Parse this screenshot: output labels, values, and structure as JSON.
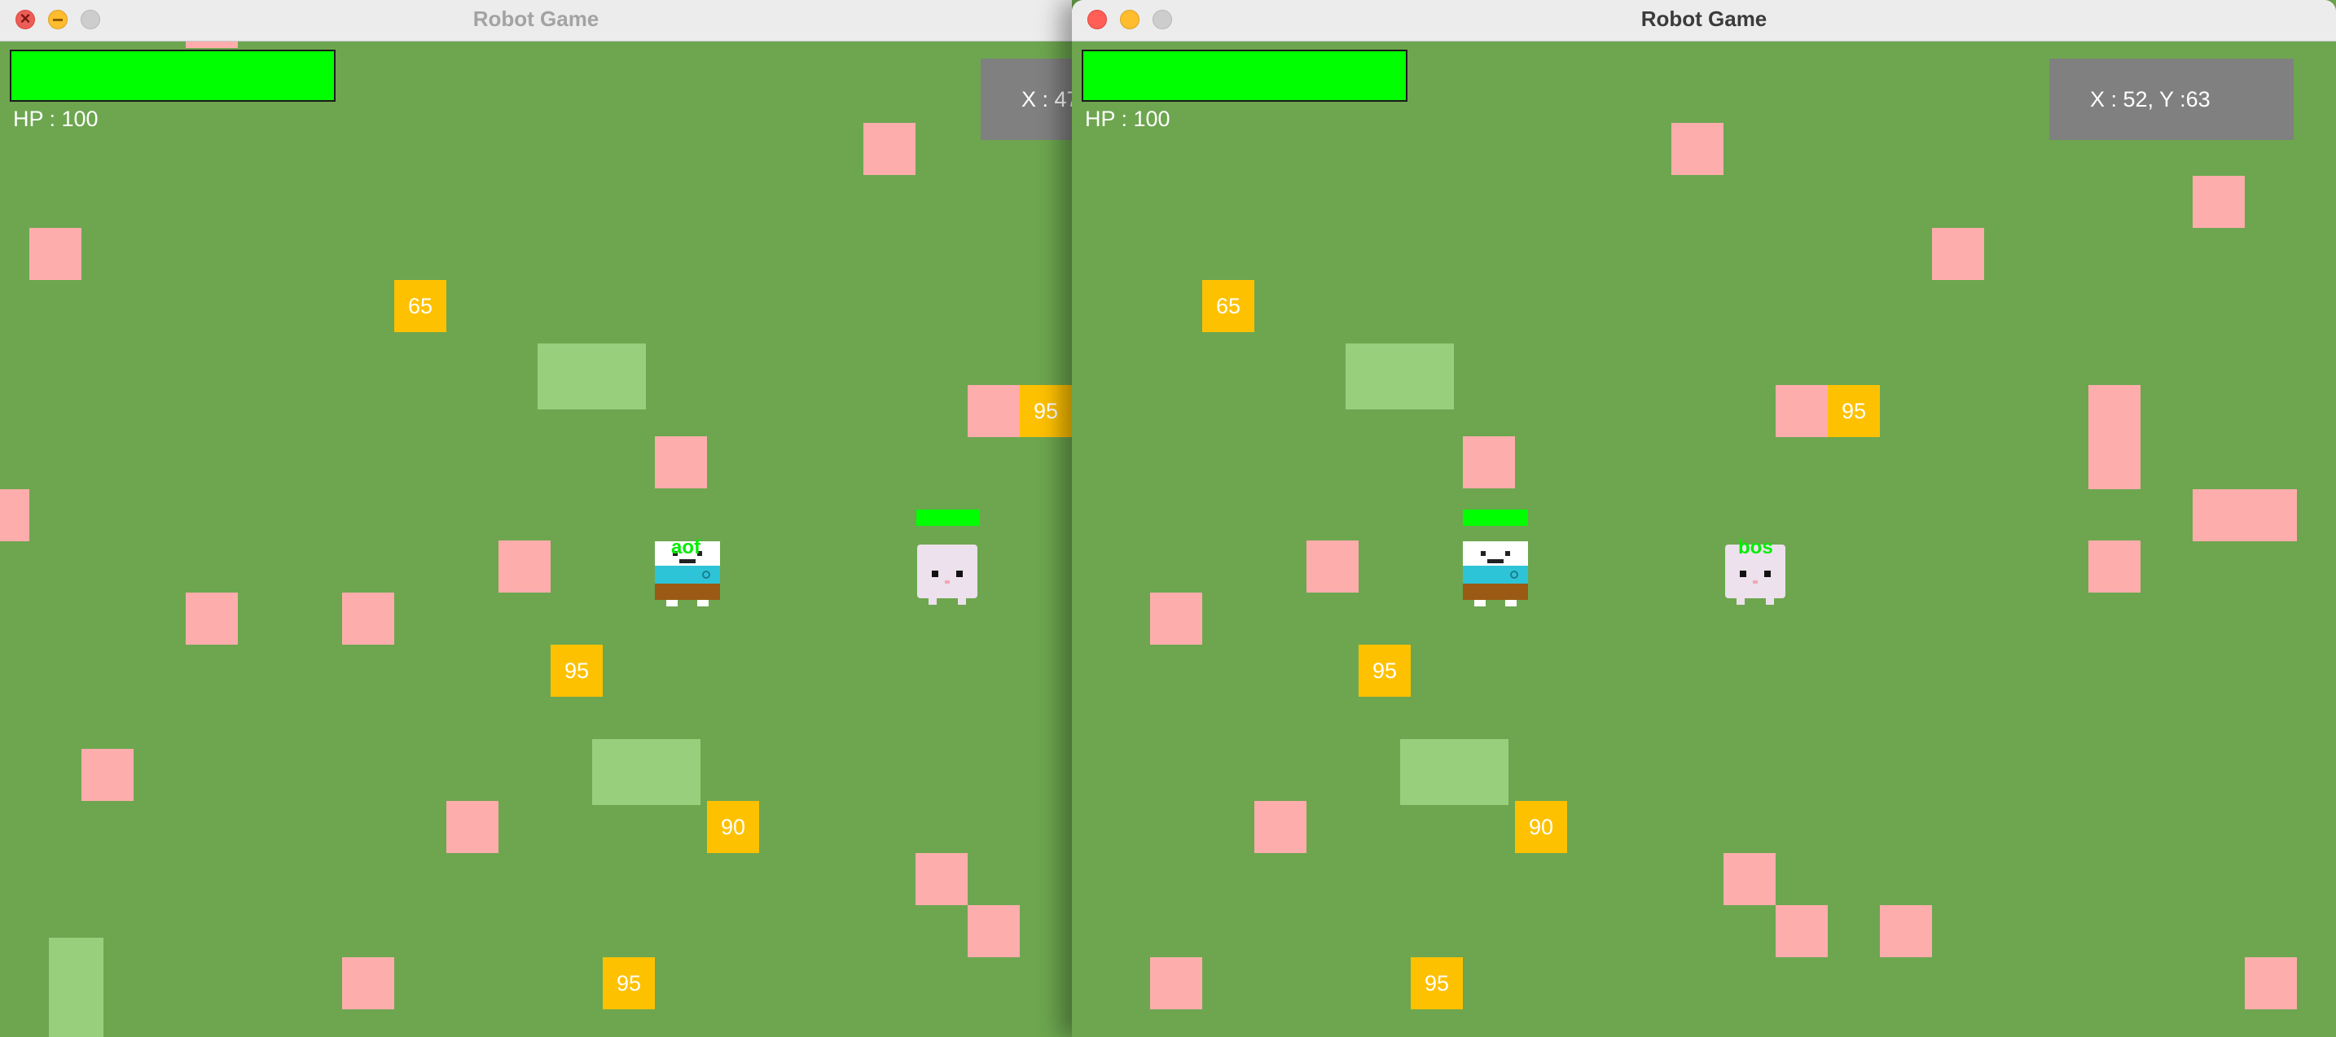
{
  "left_window": {
    "title": "Robot Game",
    "hp_text": "HP : 100",
    "coord_text": "X : 47",
    "player_name": "aof",
    "coins": {
      "c1": "65",
      "c2": "95",
      "c3": "95",
      "c4": "90",
      "c5": "95"
    }
  },
  "right_window": {
    "title": "Robot Game",
    "hp_text": "HP : 100",
    "coord_text": "X : 52, Y :63",
    "player_name": "bos",
    "coins": {
      "c1": "65",
      "c2": "95",
      "c3": "95",
      "c4": "90",
      "c5": "95"
    }
  },
  "colors": {
    "grass": "#6da64f",
    "block": "#feadad",
    "patch": "#98cf7d",
    "coin": "#fec100",
    "hp": "#00ff00",
    "coord_panel": "#808080"
  },
  "icons": [
    "close-icon",
    "minimize-icon",
    "maximize-icon",
    "robot-sprite",
    "cat-sprite"
  ]
}
